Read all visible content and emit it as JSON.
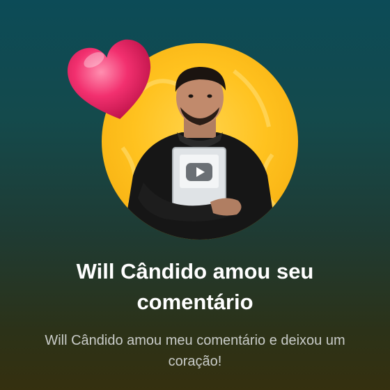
{
  "notification": {
    "title": "Will Cândido amou seu comentário",
    "message": "Will Cândido amou meu comentário e deixou um coração!",
    "reaction_icon": "heart-icon",
    "avatar_icon": "profile-photo",
    "colors": {
      "avatar_background": "#ffc21f",
      "heart": "#e8195e",
      "title": "#ffffff",
      "message": "#c9ccc9"
    }
  }
}
